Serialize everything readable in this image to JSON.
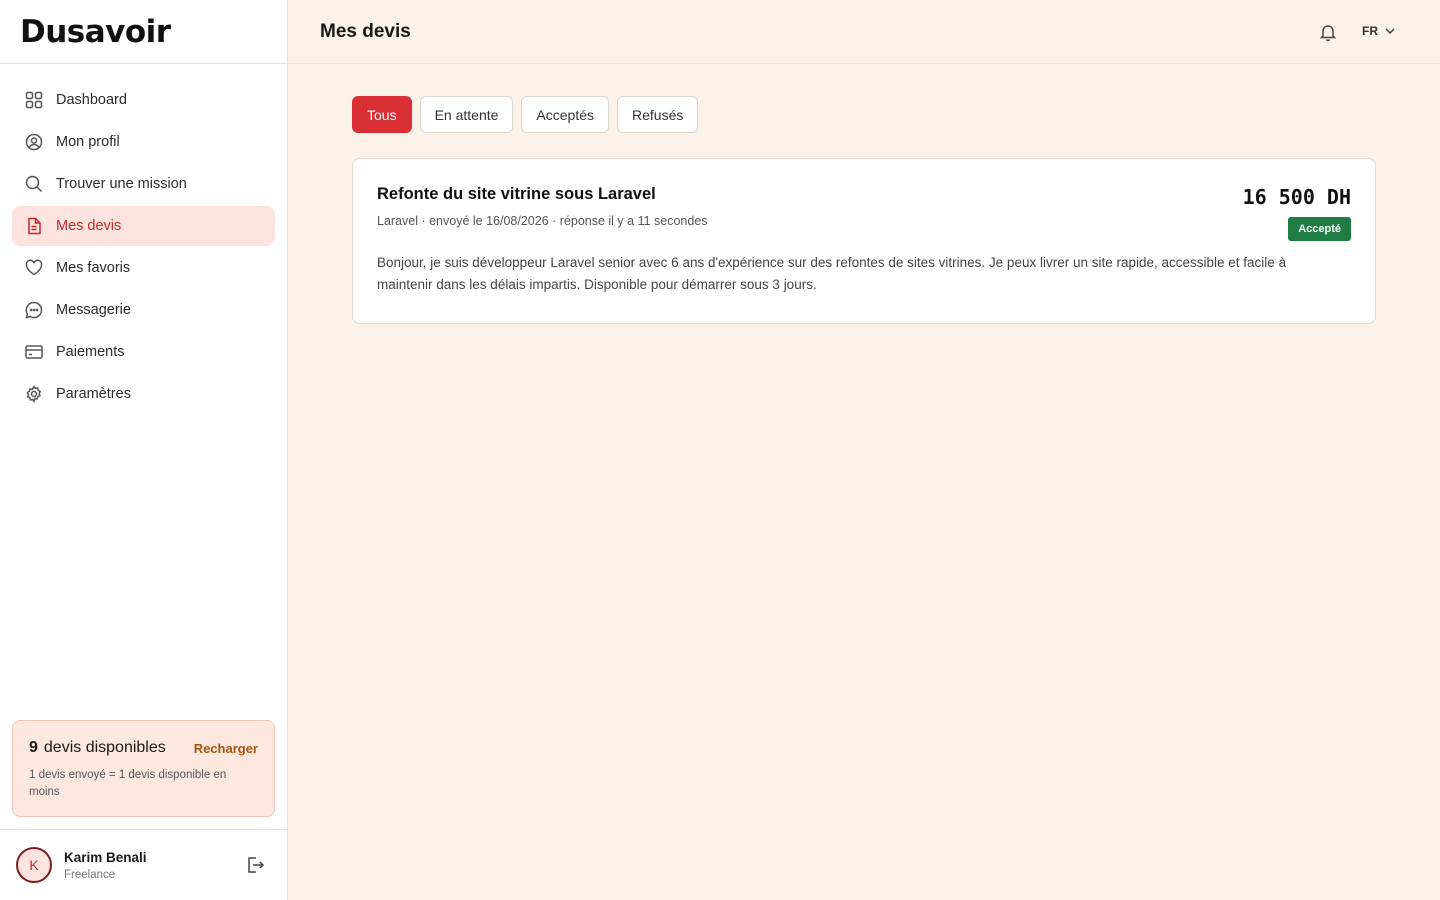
{
  "app": {
    "logo_text": "Dusavoir"
  },
  "sidebar": {
    "items": [
      {
        "label": "Dashboard",
        "icon": "grid-icon"
      },
      {
        "label": "Mon profil",
        "icon": "user-circle-icon"
      },
      {
        "label": "Trouver une mission",
        "icon": "search-icon"
      },
      {
        "label": "Mes devis",
        "icon": "document-icon",
        "active": true
      },
      {
        "label": "Mes favoris",
        "icon": "heart-icon"
      },
      {
        "label": "Messagerie",
        "icon": "chat-icon"
      },
      {
        "label": "Paiements",
        "icon": "credit-card-icon"
      },
      {
        "label": "Paramètres",
        "icon": "gear-icon"
      }
    ],
    "credits": {
      "count": "9",
      "label": "devis disponibles",
      "action": "Recharger",
      "note": "1 devis envoyé = 1 devis disponible en moins"
    },
    "user": {
      "initial": "K",
      "name": "Karim Benali",
      "role": "Freelance"
    }
  },
  "header": {
    "title": "Mes devis",
    "language": "FR"
  },
  "tabs": [
    {
      "label": "Tous",
      "active": true
    },
    {
      "label": "En attente"
    },
    {
      "label": "Acceptés"
    },
    {
      "label": "Refusés"
    }
  ],
  "quotes": [
    {
      "title": "Refonte du site vitrine sous Laravel",
      "meta": "Laravel · envoyé le 16/08/2026 · réponse il y a 11 secondes",
      "amount": "16 500 DH",
      "status": "Accepté",
      "message": "Bonjour, je suis développeur Laravel senior avec 6 ans d'expérience sur des refontes de sites vitrines. Je peux livrer un site rapide, accessible et facile à maintenir dans les délais impartis. Disponible pour démarrer sous 3 jours."
    }
  ],
  "colors": {
    "accent": "#d93036",
    "active_nav_bg": "#fde3df",
    "accepted_badge": "#1e7d45",
    "page_bg": "#faf1e8",
    "recharge_link": "#a35410"
  }
}
